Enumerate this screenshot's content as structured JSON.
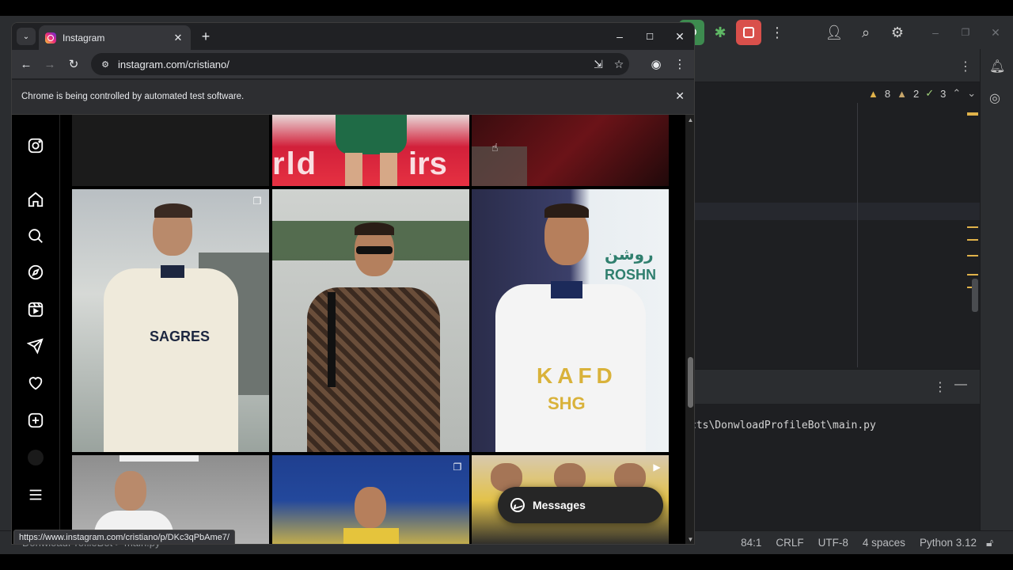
{
  "ide": {
    "inspections": {
      "warnings": "8",
      "weak_warnings": "2",
      "typos": "3"
    },
    "terminal_line": "cts\\DonwloadProfileBot\\main.py",
    "breadcrumb": "DonwloadProfileBot  >  main.py",
    "status": {
      "position": "84:1",
      "line_sep": "CRLF",
      "encoding": "UTF-8",
      "indent": "4 spaces",
      "interpreter": "Python 3.12"
    }
  },
  "browser": {
    "tab_title": "Instagram",
    "url": "instagram.com/cristiano/",
    "infobar": "Chrome is being controlled by automated test software.",
    "hover_url": "https://www.instagram.com/cristiano/p/DKc3qPbAme7/"
  },
  "instagram": {
    "nav_icons": [
      "instagram-logo-icon",
      "home-icon",
      "search-icon",
      "explore-icon",
      "reels-icon",
      "messages-icon",
      "heart-icon",
      "create-icon",
      "profile-avatar",
      "menu-icon"
    ],
    "posts": [
      {
        "row": 0,
        "col": 0,
        "desc": "dark partial post"
      },
      {
        "row": 0,
        "col": 1,
        "desc": "player in green kit"
      },
      {
        "row": 0,
        "col": 2,
        "desc": "dark red crowd"
      },
      {
        "row": 1,
        "col": 0,
        "desc": "white Portugal training top",
        "badge": "carousel"
      },
      {
        "row": 1,
        "col": 1,
        "desc": "patterned shirt with sunglasses"
      },
      {
        "row": 1,
        "col": 2,
        "desc": "Al Nassr white kit"
      },
      {
        "row": 2,
        "col": 0,
        "desc": "grey wall portrait"
      },
      {
        "row": 2,
        "col": 1,
        "desc": "yellow kit smiling",
        "badge": "carousel"
      },
      {
        "row": 2,
        "col": 2,
        "desc": "team in yellow",
        "badge": "reel"
      }
    ],
    "messages_label": "Messages"
  }
}
